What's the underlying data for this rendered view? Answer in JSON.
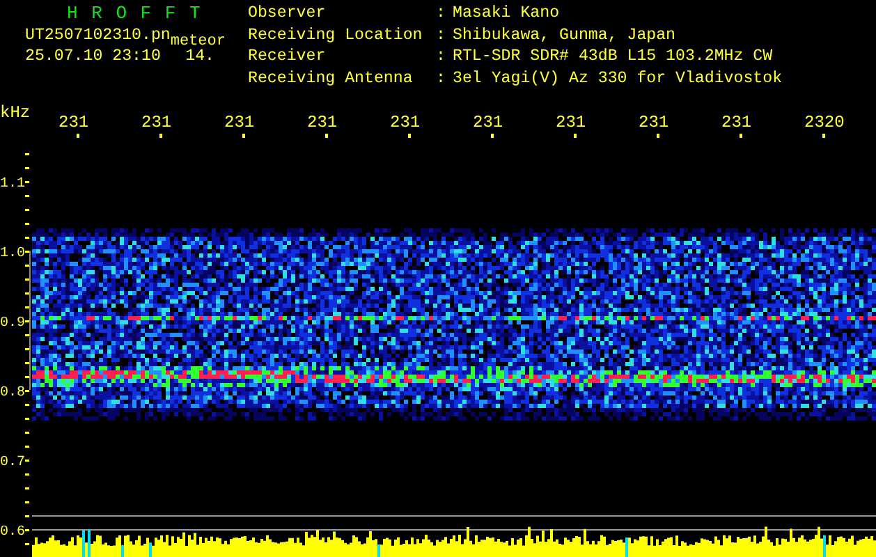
{
  "header": {
    "title": "H R O F F T",
    "filename": "UT2507102310.pn",
    "tag": "meteor",
    "datetime": "25.07.10 23:10",
    "count": "14."
  },
  "info": [
    {
      "label": "Observer",
      "separator": ":",
      "value": "Masaki Kano"
    },
    {
      "label": "Receiving Location",
      "separator": ":",
      "value": "Shibukawa, Gunma, Japan"
    },
    {
      "label": "Receiver",
      "separator": ":",
      "value": "RTL-SDR SDR# 43dB L15 103.2MHz CW"
    },
    {
      "label": "Receiving Antenna",
      "separator": ":",
      "value": "3el Yagi(V) Az 330 for Vladivostok"
    }
  ],
  "plot": {
    "y_unit": "kHz",
    "x_labels": [
      "231",
      "231",
      "231",
      "231",
      "231",
      "231",
      "231",
      "231",
      "231",
      "2320"
    ],
    "y_labels": [
      "1.1",
      "1.0",
      "0.9",
      "0.8",
      "0.7",
      "0.6"
    ]
  }
}
